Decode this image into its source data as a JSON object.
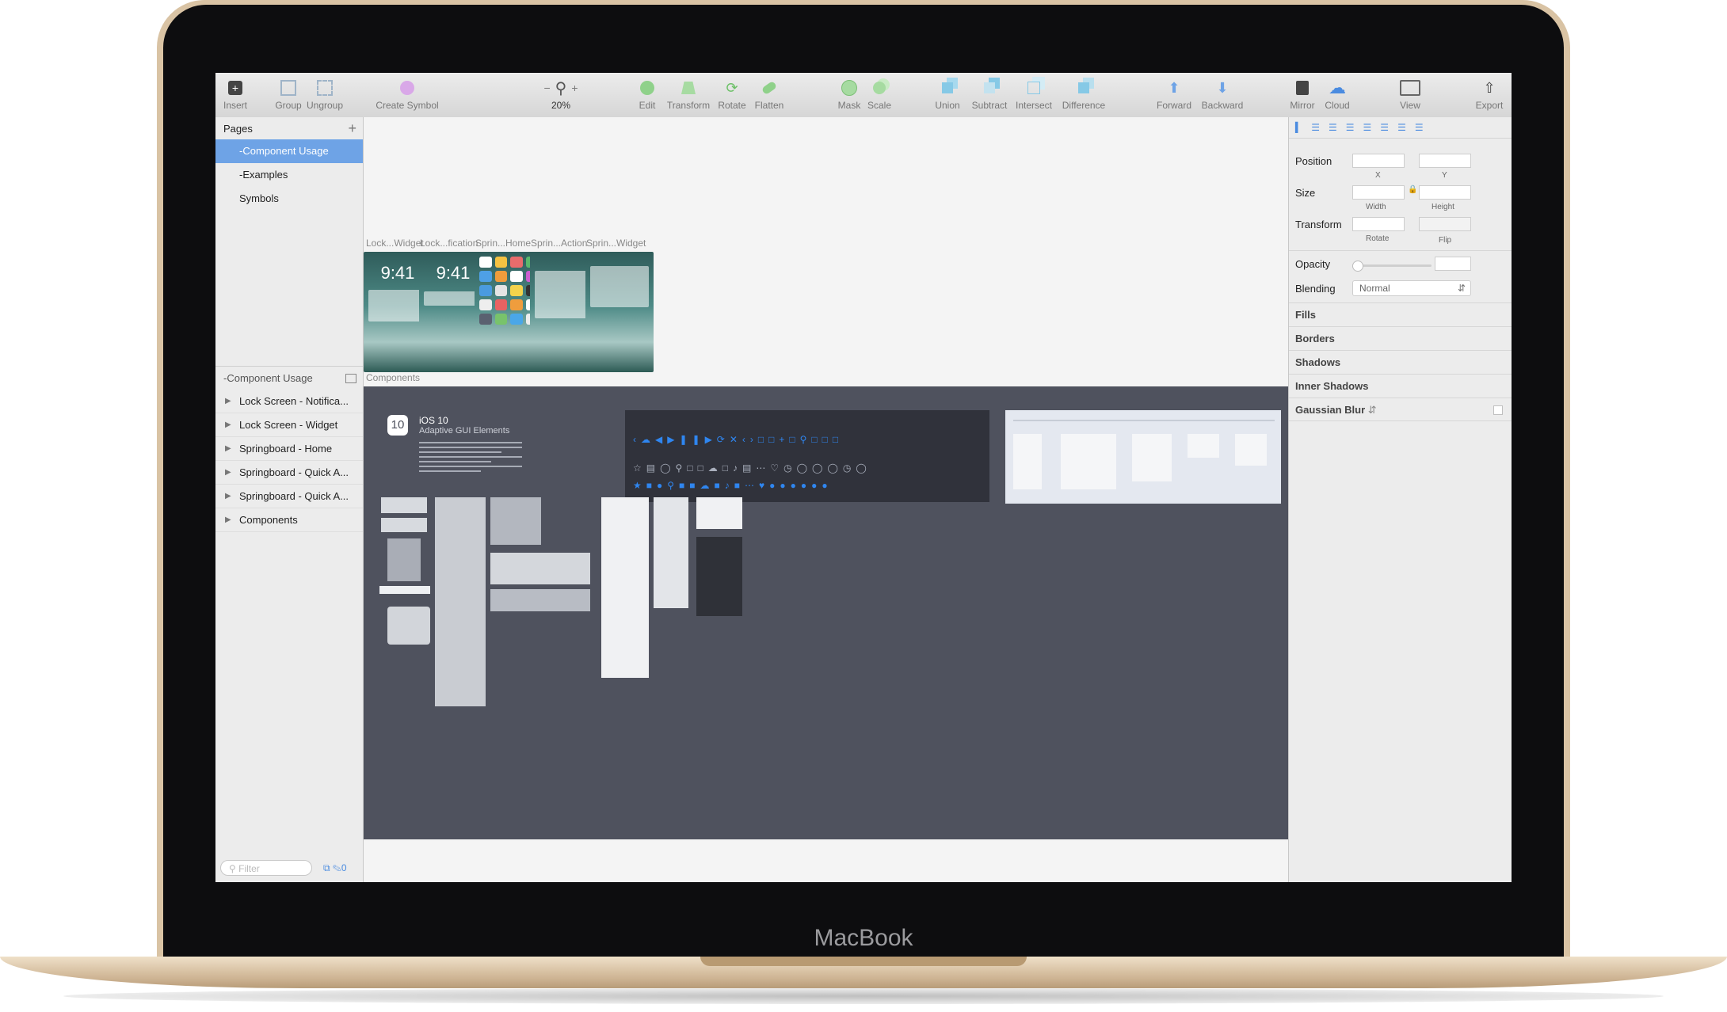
{
  "device": {
    "brand": "MacBook"
  },
  "toolbar": {
    "items": [
      {
        "label": "Insert",
        "icon": "insert-icon"
      },
      {
        "label": "Group",
        "icon": "group-icon"
      },
      {
        "label": "Ungroup",
        "icon": "ungroup-icon"
      },
      {
        "label": "Create Symbol",
        "icon": "create-symbol-icon"
      },
      {
        "label": "20%",
        "icon": "zoom-icon"
      },
      {
        "label": "Edit",
        "icon": "edit-icon"
      },
      {
        "label": "Transform",
        "icon": "transform-icon"
      },
      {
        "label": "Rotate",
        "icon": "rotate-icon"
      },
      {
        "label": "Flatten",
        "icon": "flatten-icon"
      },
      {
        "label": "Mask",
        "icon": "mask-icon"
      },
      {
        "label": "Scale",
        "icon": "scale-icon"
      },
      {
        "label": "Union",
        "icon": "union-icon"
      },
      {
        "label": "Subtract",
        "icon": "subtract-icon"
      },
      {
        "label": "Intersect",
        "icon": "intersect-icon"
      },
      {
        "label": "Difference",
        "icon": "difference-icon"
      },
      {
        "label": "Forward",
        "icon": "forward-icon"
      },
      {
        "label": "Backward",
        "icon": "backward-icon"
      },
      {
        "label": "Mirror",
        "icon": "mirror-icon"
      },
      {
        "label": "Cloud",
        "icon": "cloud-icon"
      },
      {
        "label": "View",
        "icon": "view-icon"
      },
      {
        "label": "Export",
        "icon": "export-icon"
      }
    ],
    "zoom_minus": "−",
    "zoom_plus": "+"
  },
  "sidebar": {
    "pages_title": "Pages",
    "add_page": "+",
    "pages": [
      "-Component Usage",
      "-Examples",
      "Symbols"
    ],
    "selected_page": "-Component Usage",
    "layers_title": "-Component Usage",
    "layers": [
      "Lock Screen - Notifica...",
      "Lock Screen - Widget",
      "Springboard - Home",
      "Springboard - Quick A...",
      "Springboard - Quick A...",
      "Components"
    ],
    "filter_placeholder": "Filter",
    "layer_count": "0"
  },
  "canvas": {
    "artboards": [
      {
        "label": "Lock...Widget",
        "time": "9:41"
      },
      {
        "label": "Lock...fication",
        "time": "9:41"
      },
      {
        "label": "Sprin...Home"
      },
      {
        "label": "Sprin...Action"
      },
      {
        "label": "Sprin...Widget"
      }
    ],
    "components_label": "Components",
    "ios_badge": "10",
    "ios_title": "iOS 10",
    "ios_subtitle": "Adaptive GUI Elements"
  },
  "inspector": {
    "position_label": "Position",
    "x_label": "X",
    "y_label": "Y",
    "size_label": "Size",
    "width_label": "Width",
    "height_label": "Height",
    "transform_label": "Transform",
    "rotate_label": "Rotate",
    "flip_label": "Flip",
    "opacity_label": "Opacity",
    "blending_label": "Blending",
    "blending_value": "Normal",
    "sections": [
      "Fills",
      "Borders",
      "Shadows",
      "Inner Shadows",
      "Gaussian Blur"
    ]
  },
  "colors": {
    "selection": "#6ea3e6",
    "accent": "#4a8be0",
    "board": "#4f525e",
    "laptop_gold": "#d9c3a4"
  }
}
